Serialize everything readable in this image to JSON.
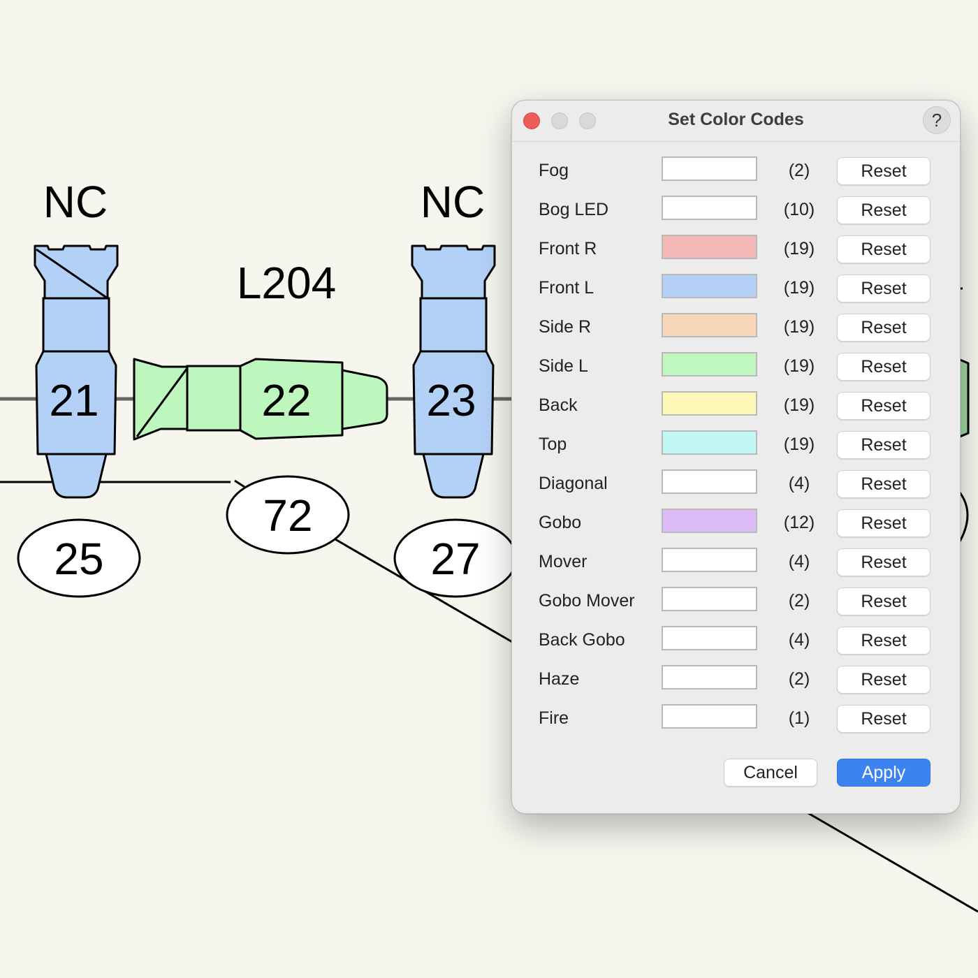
{
  "plot": {
    "labels": {
      "nc_left": "NC",
      "nc_right": "NC",
      "position": "L204"
    },
    "fixtures": {
      "f21": "21",
      "f22": "22",
      "f23": "23"
    },
    "ovals": {
      "o25": "25",
      "o72": "72",
      "o27": "27"
    },
    "colors": {
      "blue_fixture": "#b3d0f7",
      "green_fixture": "#bdf7bd"
    }
  },
  "dialog": {
    "title": "Set Color Codes",
    "help_label": "?",
    "reset_label": "Reset",
    "cancel_label": "Cancel",
    "apply_label": "Apply",
    "rows": [
      {
        "label": "Fog",
        "count": "(2)",
        "color": "#ffffff"
      },
      {
        "label": "Bog LED",
        "count": "(10)",
        "color": "#ffffff"
      },
      {
        "label": "Front R",
        "count": "(19)",
        "color": "#f4b8b6"
      },
      {
        "label": "Front L",
        "count": "(19)",
        "color": "#b5d1f8"
      },
      {
        "label": "Side R",
        "count": "(19)",
        "color": "#f7d6b9"
      },
      {
        "label": "Side L",
        "count": "(19)",
        "color": "#c0f7c0"
      },
      {
        "label": "Back",
        "count": "(19)",
        "color": "#fdf8b8"
      },
      {
        "label": "Top",
        "count": "(19)",
        "color": "#c2f8f4"
      },
      {
        "label": "Diagonal",
        "count": "(4)",
        "color": "#ffffff"
      },
      {
        "label": "Gobo",
        "count": "(12)",
        "color": "#dcbdf7"
      },
      {
        "label": "Mover",
        "count": "(4)",
        "color": "#ffffff"
      },
      {
        "label": "Gobo Mover",
        "count": "(2)",
        "color": "#ffffff"
      },
      {
        "label": "Back Gobo",
        "count": "(4)",
        "color": "#ffffff"
      },
      {
        "label": "Haze",
        "count": "(2)",
        "color": "#ffffff"
      },
      {
        "label": "Fire",
        "count": "(1)",
        "color": "#ffffff"
      }
    ]
  }
}
